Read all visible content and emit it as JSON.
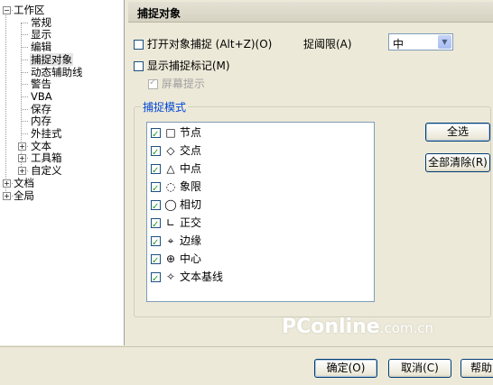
{
  "tree": {
    "items": [
      {
        "label": "工作区",
        "level": 0,
        "expander": "minus"
      },
      {
        "label": "常规",
        "level": 1
      },
      {
        "label": "显示",
        "level": 1
      },
      {
        "label": "编辑",
        "level": 1
      },
      {
        "label": "捕捉对象",
        "level": 1,
        "selected": true
      },
      {
        "label": "动态辅助线",
        "level": 1
      },
      {
        "label": "警告",
        "level": 1
      },
      {
        "label": "VBA",
        "level": 1
      },
      {
        "label": "保存",
        "level": 1
      },
      {
        "label": "内存",
        "level": 1
      },
      {
        "label": "外挂式",
        "level": 1
      },
      {
        "label": "文本",
        "level": 1,
        "expander": "plus"
      },
      {
        "label": "工具箱",
        "level": 1,
        "expander": "plus"
      },
      {
        "label": "自定义",
        "level": 1,
        "expander": "plus"
      },
      {
        "label": "文档",
        "level": 0,
        "expander": "plus"
      },
      {
        "label": "全局",
        "level": 0,
        "expander": "plus"
      }
    ]
  },
  "panel": {
    "title": "捕捉对象",
    "open_snap_label": "打开对象捕捉 (Alt+Z)(O)",
    "open_snap_checked": false,
    "threshold_label": "捉阈限(A)",
    "threshold_value": "中",
    "show_marks_label": "显示捕捉标记(M)",
    "show_marks_checked": false,
    "tooltip_label": "屏幕提示",
    "tooltip_checked": true,
    "group_title": "捕捉模式",
    "modes": [
      {
        "symbol": "□",
        "label": "节点",
        "checked": true
      },
      {
        "symbol": "◇",
        "label": "交点",
        "checked": true
      },
      {
        "symbol": "△",
        "label": "中点",
        "checked": true
      },
      {
        "symbol": "◌",
        "label": "象限",
        "checked": true
      },
      {
        "symbol": "◯",
        "label": "相切",
        "checked": true
      },
      {
        "symbol": "∟",
        "label": "正交",
        "checked": true
      },
      {
        "symbol": "⌖",
        "label": "边缘",
        "checked": true
      },
      {
        "symbol": "⊕",
        "label": "中心",
        "checked": true
      },
      {
        "symbol": "✧",
        "label": "文本基线",
        "checked": true
      }
    ],
    "select_all_label": "全选",
    "clear_all_label": "全部清除(R)"
  },
  "footer": {
    "ok_label": "确定(O)",
    "cancel_label": "取消(C)",
    "help_label": "帮助"
  },
  "watermark": {
    "text": "PConline",
    "suffix": ".com.cn"
  }
}
